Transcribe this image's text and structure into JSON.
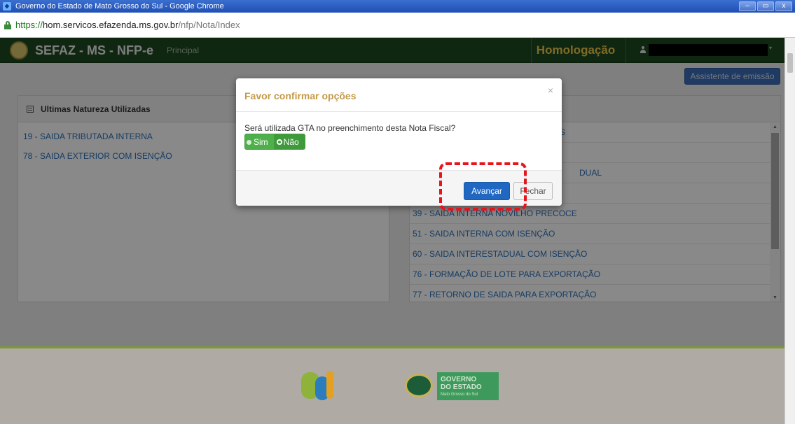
{
  "window": {
    "title": "Governo do Estado de Mato Grosso do Sul - Google Chrome",
    "controls": [
      "–",
      "▭",
      "x"
    ]
  },
  "address": {
    "scheme": "https://",
    "host": "hom.servicos.efazenda.ms.gov.br",
    "path": "/nfp/Nota/Index"
  },
  "nav": {
    "brand": "SEFAZ - MS - NFP-e",
    "principal": "Principal",
    "environment": "Homologação",
    "user_caret": "▾"
  },
  "content": {
    "assistente_button": "Assistente de emissão",
    "left_panel": {
      "title": "Ultimas Natureza Utilizadas",
      "items": [
        "19 - SAIDA TRIBUTADA INTERNA",
        "78 - SAIDA EXTERIOR COM ISENÇÃO"
      ]
    },
    "right_panel": {
      "items": [
        "S",
        "",
        "DUAL",
        "",
        "39 - SAIDA INTERNA NOVILHO PRECOCE",
        "51 - SAIDA INTERNA COM ISENÇÃO",
        "60 - SAIDA INTERESTADUAL COM ISENÇÃO",
        "76 - FORMAÇÃO DE LOTE PARA EXPORTAÇÃO",
        "77 - RETORNO DE SAIDA PARA EXPORTAÇÃO"
      ]
    }
  },
  "modal": {
    "title": "Favor confirmar opções",
    "close": "×",
    "question": "Será utilizada GTA no preenchimento desta Nota Fiscal?",
    "options": [
      "Sim",
      "Não"
    ],
    "selected": "Não",
    "primary_button": "Avançar",
    "secondary_button": "Fechar"
  },
  "footer": {
    "gov_logo_line1": "GOVERNO",
    "gov_logo_line2": "DO ESTADO",
    "gov_logo_line3": "Mato Grosso do Sul"
  },
  "colors": {
    "nav_bg": "#1d4820",
    "environment_text": "#e8c448",
    "link": "#2b6db5",
    "modal_title": "#c49a48",
    "toggle_green": "#4fb04b",
    "primary_blue": "#1f67c1",
    "annotation_red": "#e8141c"
  }
}
